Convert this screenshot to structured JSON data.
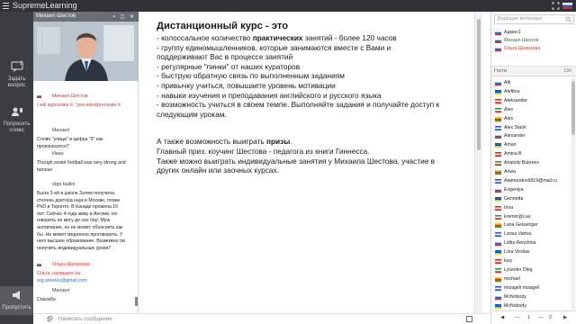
{
  "app": {
    "title": "SupremeLearning"
  },
  "leftbar": {
    "ask_label": "Задать вопрос",
    "ask_count": "2",
    "request_label": "Попросить слово",
    "mute_label": "Пропустить"
  },
  "video": {
    "presenter": "Михаил Шестов"
  },
  "chat": {
    "messages": [
      {
        "name": "",
        "text": "",
        "red": false
      },
      {
        "name": "Михаил Шестов",
        "text": "I will appreciate it. \"precieted/precieate it",
        "red": true
      },
      {
        "name": "Михаил",
        "text": "Слово \"улица\" и цифра \"3\" как произносится?",
        "red": false
      },
      {
        "name": "Иван",
        "text": "Though soviet football was very strong and famous",
        "red": false
      },
      {
        "name": "olga ballini",
        "text": "Была 3-ей в школе.Затем получила степень доктора наук в Москве, позже PhD в Торонто. В Канаде прожила 15 лет. Сейчас 4 года живу в Англии. Но говорить не могу до сих пор. Муж англичанин, но не может объяснить как бы. Не может медленно проговорить. У него высшее образование. Возможно ли получить индивидуальные уроки?",
        "red": false
      },
      {
        "name": "Ольга Шелихова",
        "text": "Ольга, напишите на",
        "link": "reg.sheelov@gmail.com",
        "red": true
      },
      {
        "name": "Михаил",
        "text": "Спасибо",
        "red": false
      }
    ],
    "input_placeholder": "Написать сообщение"
  },
  "slide": {
    "title": "Дистанционный курс - это",
    "lines": [
      {
        "pre": "- колоссальное количество ",
        "bold": "практических",
        "post": " занятий - более 120 часов"
      },
      {
        "pre": "- группу единомышленников, которые занимаются вместе с Вами и",
        "bold": "",
        "post": ""
      },
      {
        "pre": "поддерживают Вас в процессе занятий",
        "bold": "",
        "post": ""
      },
      {
        "pre": "- регулярные \"пинки\" от наших кураторов",
        "bold": "",
        "post": ""
      },
      {
        "pre": "- быструю обратную связь по выполненным заданиям",
        "bold": "",
        "post": ""
      },
      {
        "pre": "- привычку учиться, повышаете уровень мотивации",
        "bold": "",
        "post": ""
      },
      {
        "pre": "- навыки изучения и преподавания английского и русского языка",
        "bold": "",
        "post": ""
      },
      {
        "pre": "- возможность учиться в своем темпе. Выполняйте задания и получайте доступ к",
        "bold": "",
        "post": ""
      },
      {
        "pre": "следующим урокам.",
        "bold": "",
        "post": ""
      }
    ],
    "lines2": [
      {
        "pre": "А также возможность выиграть ",
        "bold": "призы",
        "post": "."
      },
      {
        "pre": "Главный приз: коучинг Шестова - педагога из книги Гиннесса.",
        "bold": "",
        "post": ""
      },
      {
        "pre": "Также можно выиграть индивидуальные занятия у Михаила Шестова, участие в",
        "bold": "",
        "post": ""
      },
      {
        "pre": "других онлайн или заочных курсах.",
        "bold": "",
        "post": ""
      }
    ]
  },
  "participants": {
    "search_placeholder": "Ведущие вебинара",
    "hosts": [
      {
        "name": "Админ1",
        "color": "dark"
      },
      {
        "name": "Михаил Шестов",
        "color": "green"
      },
      {
        "name": "Ольга Шелихова",
        "color": "red"
      }
    ],
    "guests_label": "Гости",
    "guests_count": "130",
    "guests": [
      "Alb",
      "Aleftina",
      "Aleksander",
      "Alex",
      "Alex",
      "Alex Starik",
      "Alexander",
      "Aman",
      "Amina B",
      "Anatoliy Bukreev",
      "Anwa",
      "Atamuratov6819@mail.ru",
      "Evgeniya",
      "Genrietta",
      "Irina",
      "kremin@i.ua",
      "Lana Geissinger",
      "Larisa Varina",
      "Lidiia Renzhina",
      "Lora Virslias",
      "lusy",
      "Lysenko Oleg",
      "michael",
      "mizageli mizageli",
      "McNobody",
      "McNobody"
    ],
    "pager": {
      "current": "1",
      "sep": "—",
      "total": "2"
    }
  },
  "colors": {
    "topbar": "#2f3337",
    "leftbar": "#3a3d41",
    "red_text": "#d6332e",
    "link": "#2d67c1"
  }
}
